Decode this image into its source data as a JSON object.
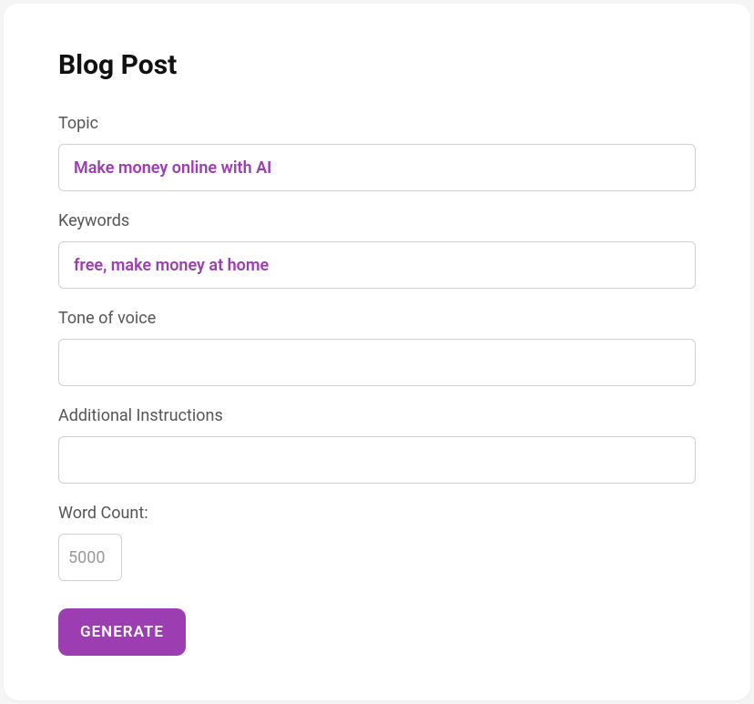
{
  "title": "Blog Post",
  "fields": {
    "topic": {
      "label": "Topic",
      "value": "Make money online with AI"
    },
    "keywords": {
      "label": "Keywords",
      "value": "free, make money at home"
    },
    "tone": {
      "label": "Tone of voice",
      "value": ""
    },
    "instructions": {
      "label": "Additional Instructions",
      "value": ""
    },
    "wordcount": {
      "label": "Word Count:",
      "value": "5000"
    }
  },
  "buttons": {
    "generate": "GENERATE"
  },
  "colors": {
    "accent": "#9c3db1"
  }
}
